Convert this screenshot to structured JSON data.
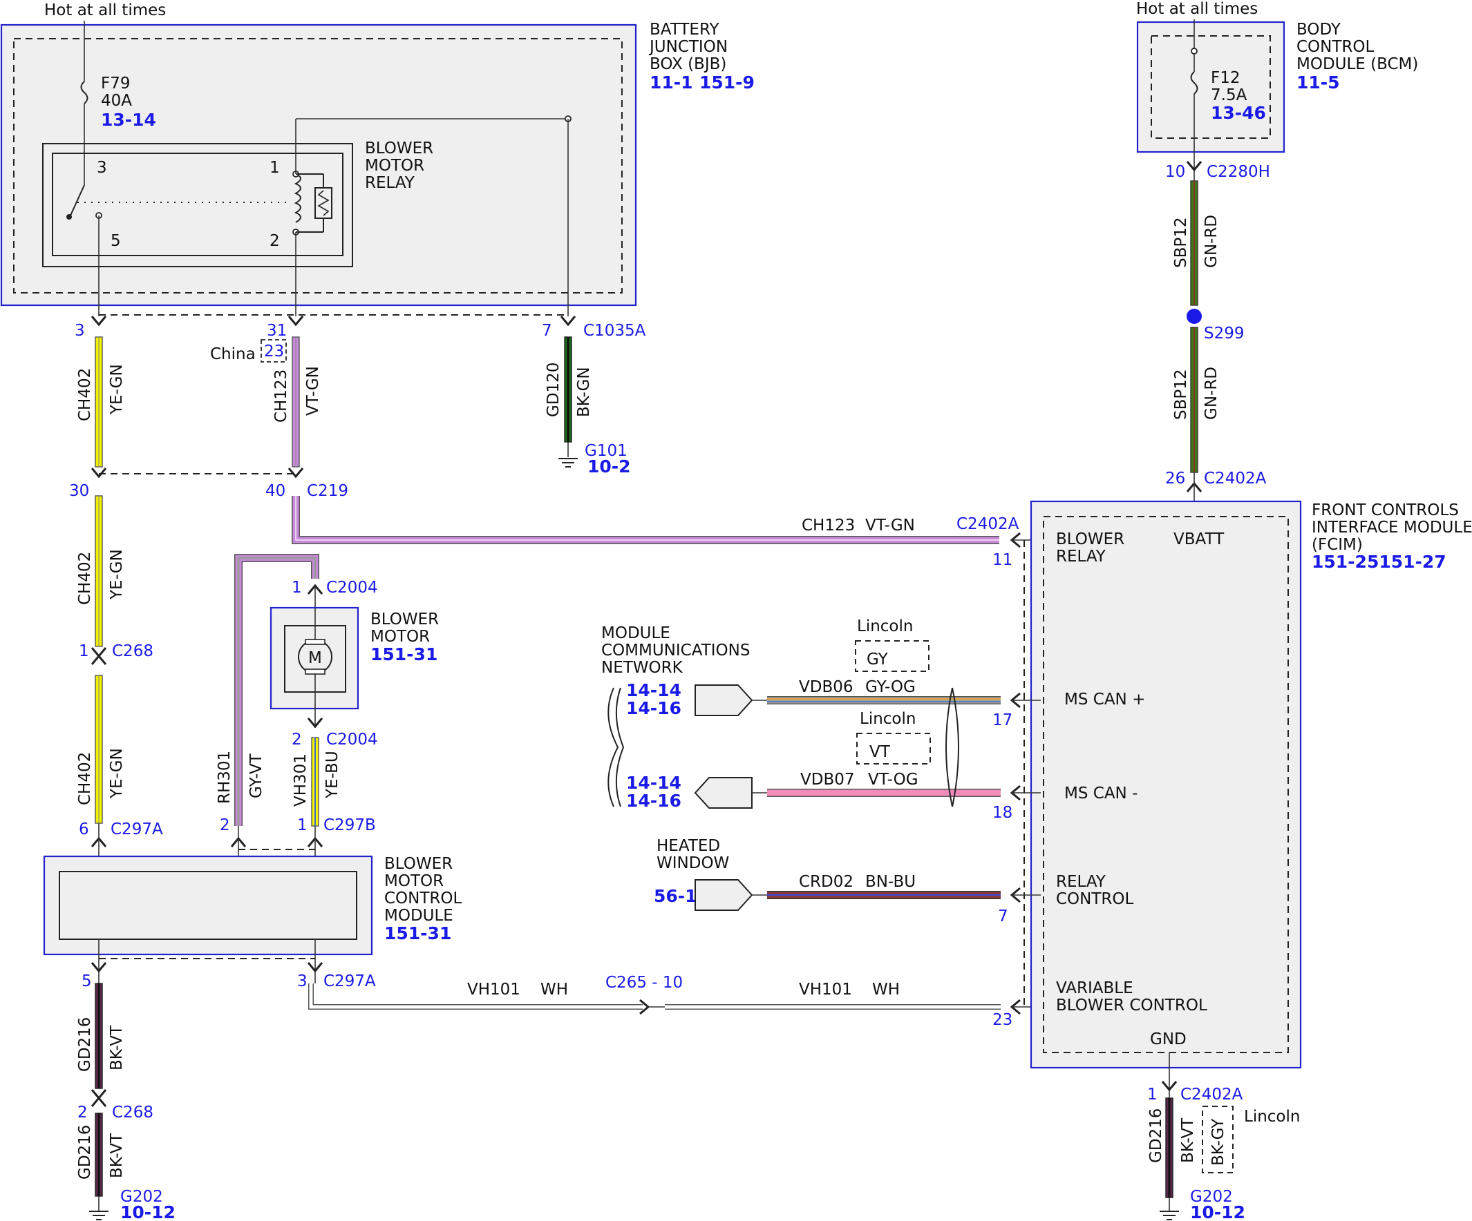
{
  "modules": {
    "bjb": {
      "name": [
        "BATTERY",
        "JUNCTION",
        "BOX (BJB)"
      ],
      "refs": [
        "11-1",
        "151-9"
      ]
    },
    "bcm": {
      "name": [
        "BODY",
        "CONTROL",
        "MODULE (BCM)"
      ],
      "ref": "11-5"
    },
    "fcim": {
      "name": [
        "FRONT CONTROLS",
        "INTERFACE MODULE",
        "(FCIM)"
      ],
      "ref": "151-25151-27",
      "pins": {
        "blower_relay": [
          "BLOWER",
          "RELAY"
        ],
        "vbatt": "VBATT",
        "ms_can_plus": "MS CAN +",
        "ms_can_minus": "MS CAN -",
        "relay_control": [
          "RELAY",
          "CONTROL"
        ],
        "variable_blower": [
          "VARIABLE",
          "BLOWER CONTROL"
        ],
        "gnd": "GND"
      }
    },
    "blower_motor": {
      "name": [
        "BLOWER",
        "MOTOR"
      ],
      "ref": "151-31",
      "symbol": "M"
    },
    "bmcm": {
      "name": [
        "BLOWER",
        "MOTOR",
        "CONTROL",
        "MODULE"
      ],
      "ref": "151-31"
    },
    "relay": {
      "name": [
        "BLOWER",
        "MOTOR",
        "RELAY"
      ],
      "pins": [
        "3",
        "1",
        "5",
        "2"
      ]
    }
  },
  "hot_label": "Hot at all times",
  "fuses": {
    "f79": {
      "name": "F79",
      "rating": "40A",
      "ref": "13-14"
    },
    "f12": {
      "name": "F12",
      "rating": "7.5A",
      "ref": "13-46"
    }
  },
  "connectors": {
    "bjb_3": {
      "pin": "3"
    },
    "bjb_31": {
      "pin": "31"
    },
    "china_23": {
      "pin": "23",
      "note": "China"
    },
    "c1035a": {
      "pin": "7",
      "name": "C1035A"
    },
    "c219_30": {
      "pin": "30"
    },
    "c219": {
      "pin": "40",
      "name": "C219"
    },
    "c268_1": {
      "pin": "1",
      "name": "C268"
    },
    "c2004_1": {
      "pin": "1",
      "name": "C2004"
    },
    "c2004_2": {
      "pin": "2",
      "name": "C2004"
    },
    "c297a_6": {
      "pin": "6",
      "name": "C297A"
    },
    "c297b_2": {
      "pin": "2"
    },
    "c297b_1": {
      "pin": "1",
      "name": "C297B"
    },
    "c297a_5": {
      "pin": "5"
    },
    "c297a_3": {
      "pin": "3",
      "name": "C297A"
    },
    "c268_2": {
      "pin": "2",
      "name": "C268"
    },
    "c2280h": {
      "pin": "10",
      "name": "C2280H"
    },
    "c2402a_26": {
      "pin": "26",
      "name": "C2402A"
    },
    "c2402a_11": {
      "pin": "11",
      "name": "C2402A"
    },
    "p17": {
      "pin": "17"
    },
    "p18": {
      "pin": "18"
    },
    "p7": {
      "pin": "7"
    },
    "p23": {
      "pin": "23"
    },
    "c2402a_1": {
      "pin": "1",
      "name": "C2402A"
    },
    "c265": {
      "label": "C265 - 10"
    }
  },
  "wires": {
    "ch402_a": {
      "circuit": "CH402",
      "color": "YE-GN"
    },
    "ch123_a": {
      "circuit": "CH123",
      "color": "VT-GN"
    },
    "gd120": {
      "circuit": "GD120",
      "color": "BK-GN"
    },
    "ch402_b": {
      "circuit": "CH402",
      "color": "YE-GN"
    },
    "ch402_c": {
      "circuit": "CH402",
      "color": "YE-GN"
    },
    "ch123_b": {
      "circuit": "CH123",
      "color": "VT-GN"
    },
    "rh301": {
      "circuit": "RH301",
      "color": "GY-VT"
    },
    "vh301": {
      "circuit": "VH301",
      "color": "YE-BU"
    },
    "gd216_a": {
      "circuit": "GD216",
      "color": "BK-VT"
    },
    "gd216_b": {
      "circuit": "GD216",
      "color": "BK-VT"
    },
    "sbp12_a": {
      "circuit": "SBP12",
      "color": "GN-RD"
    },
    "sbp12_b": {
      "circuit": "SBP12",
      "color": "GN-RD"
    },
    "vdb06": {
      "circuit": "VDB06",
      "color": "GY-OG",
      "alt_note": "Lincoln",
      "alt_color": "GY"
    },
    "vdb07": {
      "circuit": "VDB07",
      "color": "VT-OG",
      "alt_note": "Lincoln",
      "alt_color": "VT"
    },
    "crd02": {
      "circuit": "CRD02",
      "color": "BN-BU"
    },
    "vh101_a": {
      "circuit": "VH101",
      "color": "WH"
    },
    "vh101_b": {
      "circuit": "VH101",
      "color": "WH"
    },
    "gd216_c": {
      "circuit": "GD216",
      "color": "BK-VT",
      "alt_note": "Lincoln",
      "alt_color": "BK-GY"
    }
  },
  "splice": {
    "name": "S299"
  },
  "grounds": {
    "g101": {
      "name": "G101",
      "ref": "10-2"
    },
    "g202a": {
      "name": "G202",
      "ref": "10-12"
    },
    "g202b": {
      "name": "G202",
      "ref": "10-12"
    }
  },
  "network": {
    "title": [
      "MODULE",
      "COMMUNICATIONS",
      "NETWORK"
    ],
    "refs_plus": [
      "14-14",
      "14-16"
    ],
    "refs_minus": [
      "14-14",
      "14-16"
    ]
  },
  "heated_window": {
    "title": [
      "HEATED",
      "WINDOW"
    ],
    "ref": "56-1"
  },
  "colors": {
    "blue": "#1a1ae6",
    "module_fill": "#efefef",
    "yellow": "#f0f000",
    "violet": "#c88ad8",
    "green": "#3a7a1a",
    "pink": "#f08cb8"
  }
}
